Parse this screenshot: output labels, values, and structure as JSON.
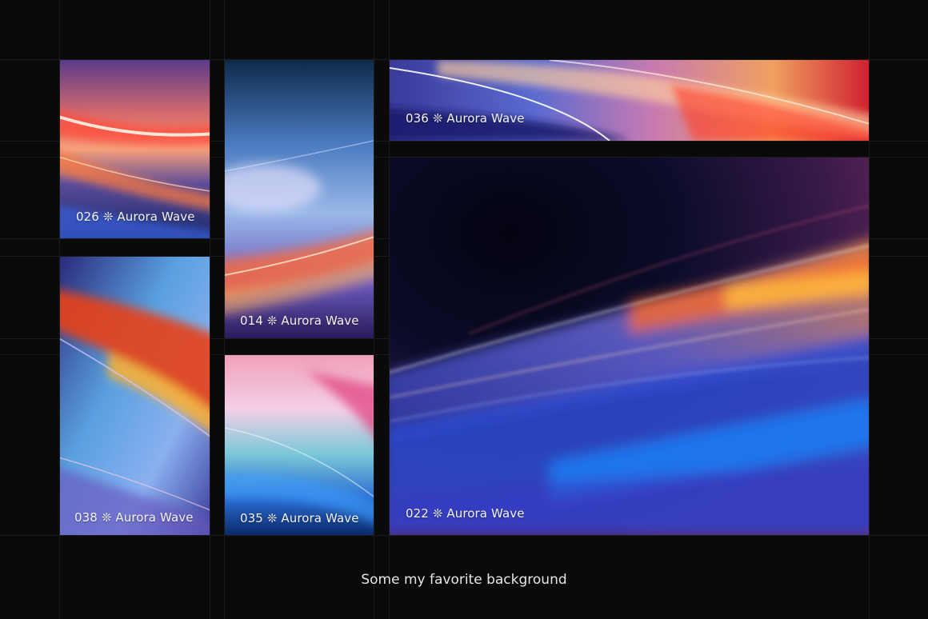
{
  "gallery": {
    "separator": "❊",
    "tiles": [
      {
        "number": "026",
        "name": "Aurora Wave"
      },
      {
        "number": "038",
        "name": "Aurora Wave"
      },
      {
        "number": "014",
        "name": "Aurora Wave"
      },
      {
        "number": "035",
        "name": "Aurora Wave"
      },
      {
        "number": "036",
        "name": "Aurora Wave"
      },
      {
        "number": "022",
        "name": "Aurora Wave"
      }
    ]
  },
  "footer": {
    "text": "Some my favorite background"
  },
  "colors": {
    "background": "#0a0a0a",
    "grid": "#1b1b1b",
    "caption": "#f2f2f2"
  }
}
